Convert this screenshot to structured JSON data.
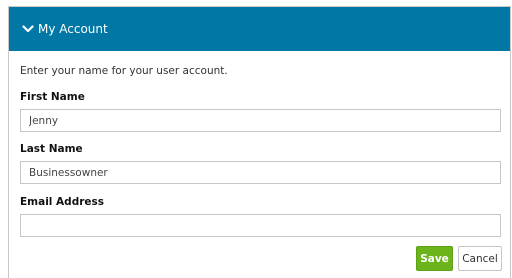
{
  "section": {
    "title": "My Account",
    "icon": "chevron-down-icon",
    "header_color": "#0077a5"
  },
  "form": {
    "intro": "Enter your name for your user account.",
    "first_name": {
      "label": "First Name",
      "value": "Jenny"
    },
    "last_name": {
      "label": "Last Name",
      "value": "Businessowner"
    },
    "email": {
      "label": "Email Address",
      "value": ""
    }
  },
  "actions": {
    "save_label": "Save",
    "cancel_label": "Cancel",
    "save_color": "#6cb41b"
  }
}
